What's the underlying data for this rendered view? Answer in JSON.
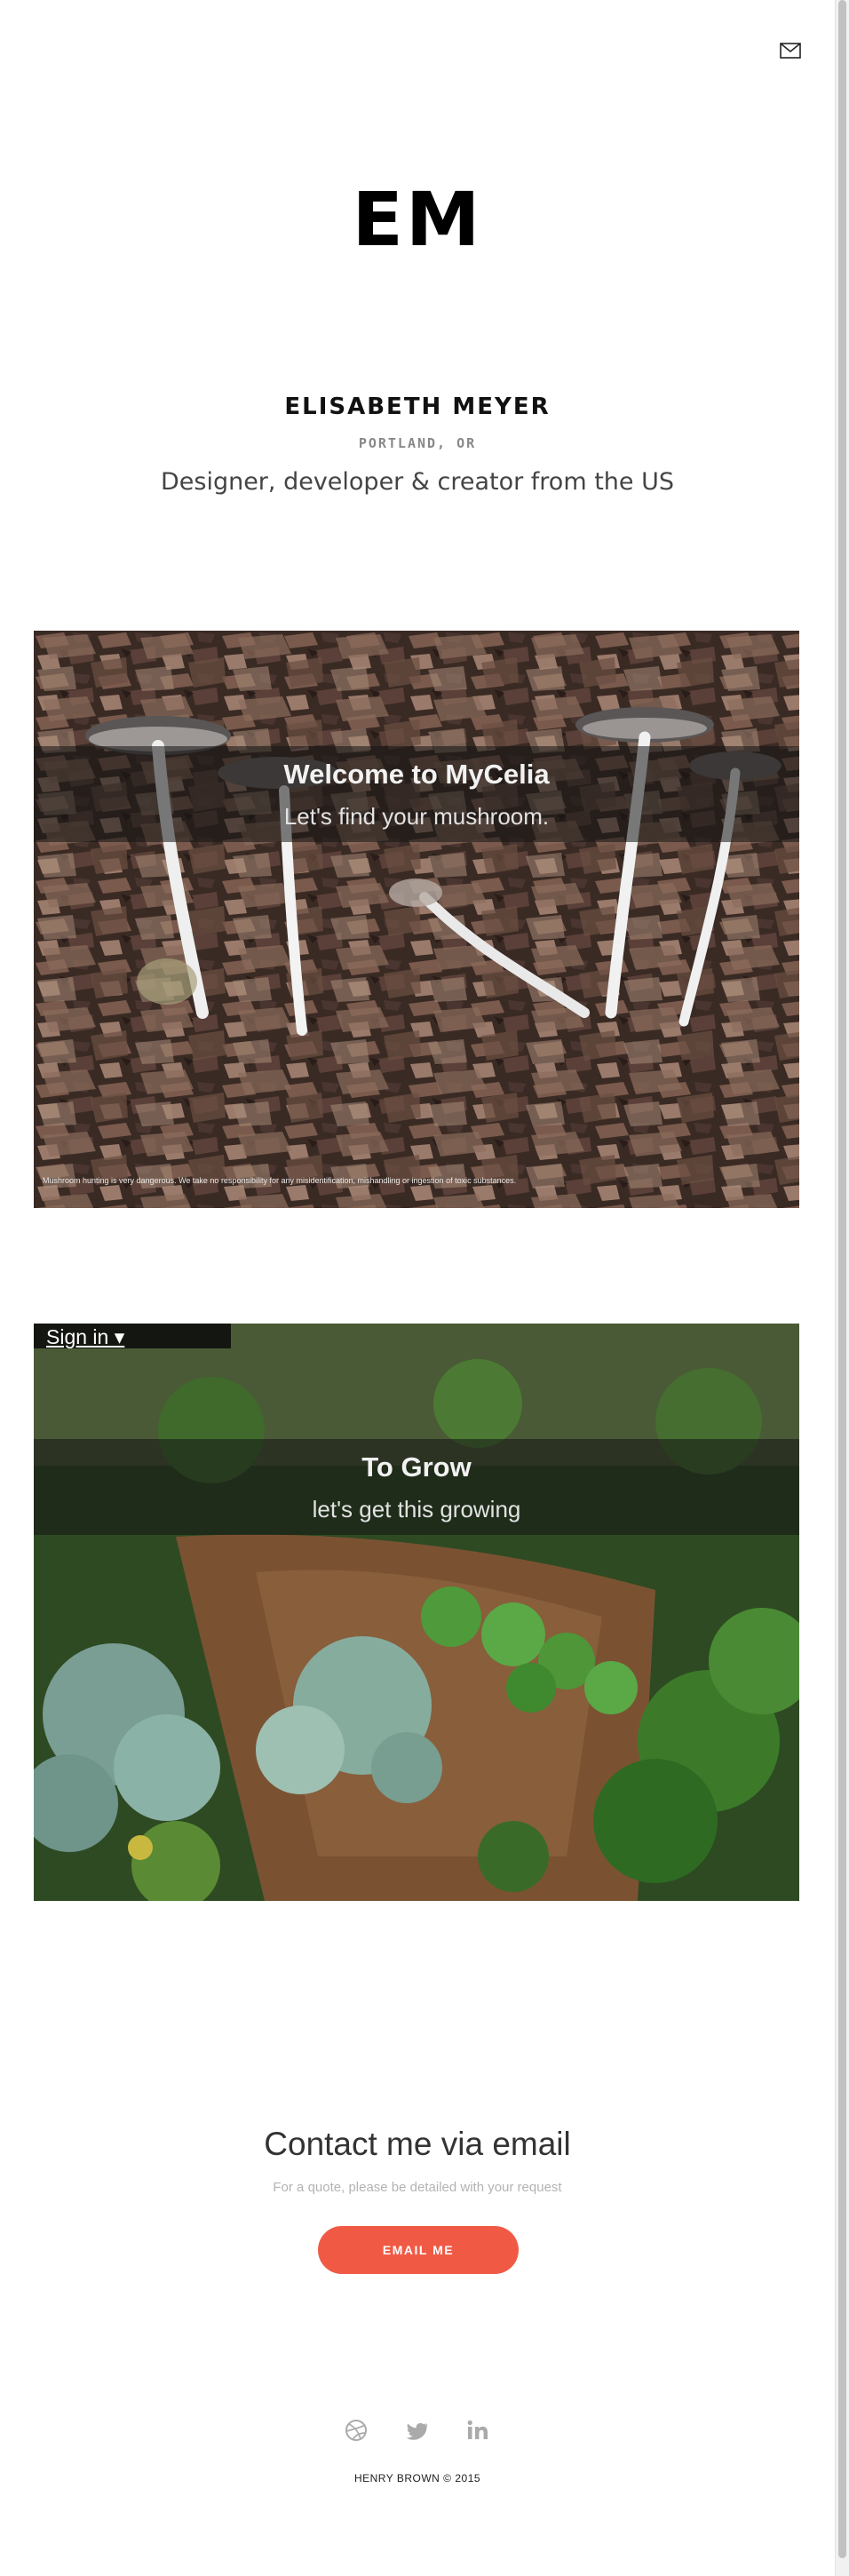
{
  "header": {
    "email_icon": "envelope-icon"
  },
  "hero": {
    "logo": "EM",
    "name": "ELISABETH MEYER",
    "location": "PORTLAND, OR",
    "tagline": "Designer, developer & creator from the US"
  },
  "cards": [
    {
      "title": "Welcome to MyCelia",
      "subtitle": "Let's find your mushroom.",
      "disclaimer": "Mushroom hunting is very dangerous. We take no responsibility for any misidentification, mishandling or ingestion of toxic substances."
    },
    {
      "title": "To Grow",
      "subtitle": "let's get this growing",
      "signin_label": "Sign in ▾"
    }
  ],
  "contact": {
    "title": "Contact me via email",
    "subtitle": "For a quote, please be detailed with your request",
    "button_label": "EMAIL ME",
    "button_color": "#f05a45"
  },
  "social": {
    "icons": [
      "dribbble-icon",
      "twitter-icon",
      "linkedin-icon"
    ]
  },
  "footer": {
    "text": "HENRY BROWN © 2015"
  }
}
